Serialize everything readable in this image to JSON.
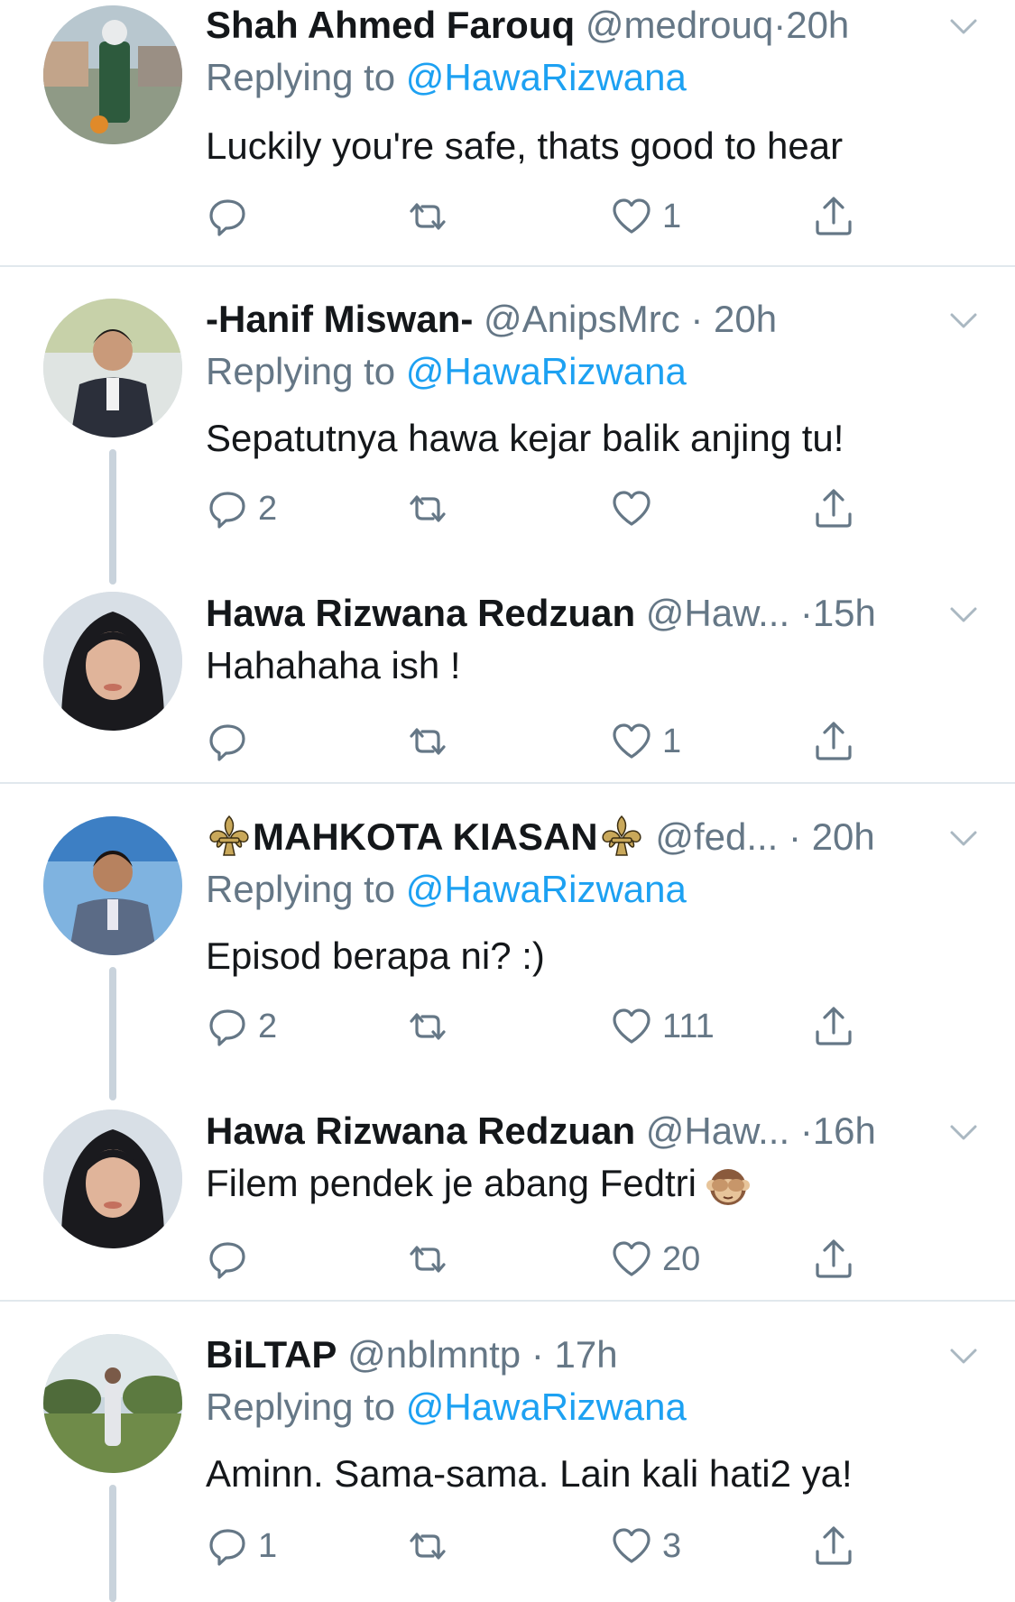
{
  "colors": {
    "text": "#14171a",
    "secondary": "#657786",
    "link": "#1da1f2",
    "divider": "#e1e8ed",
    "thread_line": "#c9d3dc"
  },
  "tweets": [
    {
      "name": "Shah Ahmed Farouq",
      "handle": "@medrouq",
      "sep": "·",
      "time": "20h",
      "replying_prefix": "Replying to",
      "replying_to": "@HawaRizwana",
      "text": "Luckily you're safe, thats good to hear",
      "reply_count": "",
      "like_count": "1"
    },
    {
      "name": "-Hanif Miswan-",
      "handle": "@AnipsMrc",
      "sep": "·",
      "time": "20h",
      "replying_prefix": "Replying to",
      "replying_to": "@HawaRizwana",
      "text": "Sepatutnya hawa kejar balik anjing tu!",
      "reply_count": "2",
      "like_count": ""
    },
    {
      "name": "Hawa Rizwana Redzuan",
      "handle": "@Haw...",
      "sep": "·",
      "time": "15h",
      "text": "Hahahaha ish !",
      "reply_count": "",
      "like_count": "1"
    },
    {
      "name": "MAHKOTA KIASAN",
      "handle": "@fed...",
      "sep": "·",
      "time": "20h",
      "replying_prefix": "Replying to",
      "replying_to": "@HawaRizwana",
      "text": "Episod berapa ni? :)",
      "reply_count": "2",
      "like_count": "111"
    },
    {
      "name": "Hawa Rizwana Redzuan",
      "handle": "@Haw...",
      "sep": "·",
      "time": "16h",
      "text": "Filem pendek je abang Fedtri",
      "emoji": "see-no-evil-monkey",
      "reply_count": "",
      "like_count": "20"
    },
    {
      "name": "BiLTAP",
      "handle": "@nblmntp",
      "sep": "·",
      "time": "17h",
      "replying_prefix": "Replying to",
      "replying_to": "@HawaRizwana",
      "text": "Aminn. Sama-sama. Lain kali hati2 ya!",
      "reply_count": "1",
      "like_count": "3"
    }
  ],
  "icons": {
    "reply": "reply-icon",
    "retweet": "retweet-icon",
    "like": "heart-icon",
    "share": "share-icon",
    "menu": "chevron-down-icon",
    "name_decoration": "fleur-de-lis-icon"
  }
}
